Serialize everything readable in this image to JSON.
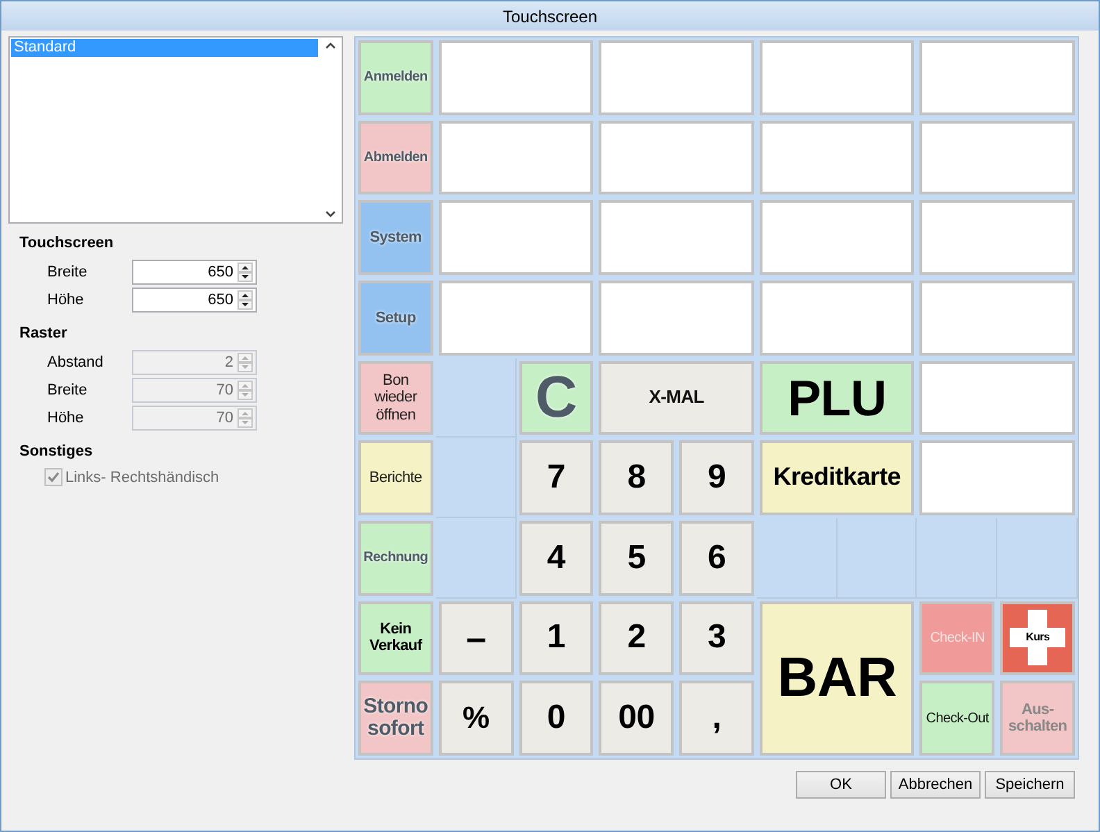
{
  "window": {
    "title": "Touchscreen"
  },
  "layouts": [
    {
      "label": "Standard",
      "selected": true
    }
  ],
  "touchscreen": {
    "heading": "Touchscreen",
    "fields": [
      {
        "label": "Breite",
        "value": "650",
        "disabled": false
      },
      {
        "label": "Höhe",
        "value": "650",
        "disabled": false
      }
    ]
  },
  "raster": {
    "heading": "Raster",
    "fields": [
      {
        "label": "Abstand",
        "value": "2",
        "disabled": true
      },
      {
        "label": "Breite",
        "value": "70",
        "disabled": true
      },
      {
        "label": "Höhe",
        "value": "70",
        "disabled": true
      }
    ]
  },
  "other": {
    "heading": "Sonstiges",
    "checkbox": {
      "label": "Links- Rechtshändisch",
      "checked": true,
      "disabled": true
    }
  },
  "keys": [
    {
      "kind": "key",
      "label": "Anmelden",
      "color": "#c6efc6"
    },
    {
      "kind": "blank"
    },
    {
      "kind": "blank"
    },
    {
      "kind": "blank"
    },
    {
      "kind": "blank"
    },
    {
      "kind": "key",
      "label": "Abmelden",
      "color": "#f2c6c6"
    },
    {
      "kind": "blank"
    },
    {
      "kind": "blank"
    },
    {
      "kind": "blank"
    },
    {
      "kind": "blank"
    },
    {
      "kind": "key",
      "label": "System",
      "color": "#93c2f0"
    },
    {
      "kind": "blank"
    },
    {
      "kind": "blank"
    },
    {
      "kind": "blank"
    },
    {
      "kind": "blank"
    },
    {
      "kind": "key",
      "label": "Setup",
      "color": "#93c2f0"
    },
    {
      "kind": "blank"
    },
    {
      "kind": "blank"
    },
    {
      "kind": "blank"
    },
    {
      "kind": "blank"
    },
    {
      "kind": "key",
      "label": "Bon wieder öffnen",
      "color": "#f2c6c6"
    },
    {
      "kind": "key",
      "label": "C",
      "color": "#c6efc6"
    },
    {
      "kind": "key",
      "label": "X-MAL",
      "color": "#ecebe6"
    },
    {
      "kind": "key",
      "label": "PLU",
      "color": "#c6efc6"
    },
    {
      "kind": "blank"
    },
    {
      "kind": "key",
      "label": "Berichte",
      "color": "#f5f2c6"
    },
    {
      "kind": "key",
      "label": "7",
      "color": "#ecebe6"
    },
    {
      "kind": "key",
      "label": "8",
      "color": "#ecebe6"
    },
    {
      "kind": "key",
      "label": "9",
      "color": "#ecebe6"
    },
    {
      "kind": "key",
      "label": "Kreditkarte",
      "color": "#f5f2c6"
    },
    {
      "kind": "blank"
    },
    {
      "kind": "key",
      "label": "Rechnung",
      "color": "#c6efc6"
    },
    {
      "kind": "key",
      "label": "4",
      "color": "#ecebe6"
    },
    {
      "kind": "key",
      "label": "5",
      "color": "#ecebe6"
    },
    {
      "kind": "key",
      "label": "6",
      "color": "#ecebe6"
    },
    {
      "kind": "key",
      "label": "Kein Verkauf",
      "color": "#c6efc6"
    },
    {
      "kind": "key",
      "label": "–",
      "color": "#ecebe6"
    },
    {
      "kind": "key",
      "label": "1",
      "color": "#ecebe6"
    },
    {
      "kind": "key",
      "label": "2",
      "color": "#ecebe6"
    },
    {
      "kind": "key",
      "label": "3",
      "color": "#ecebe6"
    },
    {
      "kind": "key",
      "label": "BAR",
      "color": "#f5f2c6"
    },
    {
      "kind": "key",
      "label": "Check-IN",
      "color": "#f09a9a"
    },
    {
      "kind": "cross",
      "label": "Kurs",
      "color": "#e66656"
    },
    {
      "kind": "key",
      "label": "Storno sofort",
      "color": "#f2c6c6"
    },
    {
      "kind": "key",
      "label": "%",
      "color": "#ecebe6"
    },
    {
      "kind": "key",
      "label": "0",
      "color": "#ecebe6"
    },
    {
      "kind": "key",
      "label": "00",
      "color": "#ecebe6"
    },
    {
      "kind": "key",
      "label": ",",
      "color": "#ecebe6"
    },
    {
      "kind": "key",
      "label": "Check-Out",
      "color": "#c6efc6"
    },
    {
      "kind": "key",
      "label": "Aus- schalten",
      "color": "#f2c6c6"
    }
  ],
  "buttons": [
    {
      "label": "OK"
    },
    {
      "label": "Abbrechen"
    },
    {
      "label": "Speichern"
    }
  ]
}
